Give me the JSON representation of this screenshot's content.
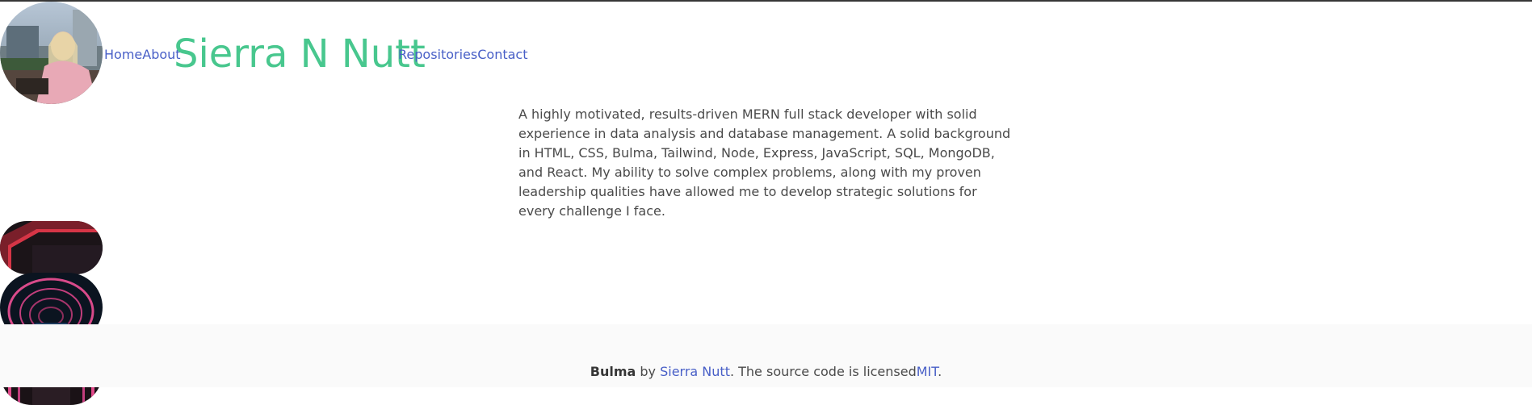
{
  "header": {
    "avatar_alt": "avatar",
    "nav_left": [
      "Home",
      "About"
    ],
    "brand": "Sierra N Nutt",
    "nav_right": [
      "Repositories",
      "Contact"
    ]
  },
  "bio": {
    "text": "A highly motivated, results-driven MERN full stack developer with solid experience in data analysis and database management. A solid background in HTML, CSS, Bulma, Tailwind, Node, Express, JavaScript, SQL, MongoDB, and React. My ability to solve complex problems, along with my proven leadership qualities have allowed me to develop strategic solutions for every challenge I face."
  },
  "footer": {
    "brand": "Bulma",
    "by": " by ",
    "author": "Sierra Nutt",
    "license_text": ". The source code is licensed",
    "license": "MIT",
    "end": "."
  },
  "colors": {
    "link": "#485fc7",
    "brand": "#48c78e",
    "text": "#4a4a4a",
    "footer_bg": "#fafafa"
  },
  "icons": [
    "avatar-photo",
    "red-light-tunnel-image",
    "neon-ring-tunnel-image",
    "neon-corridor-image"
  ]
}
